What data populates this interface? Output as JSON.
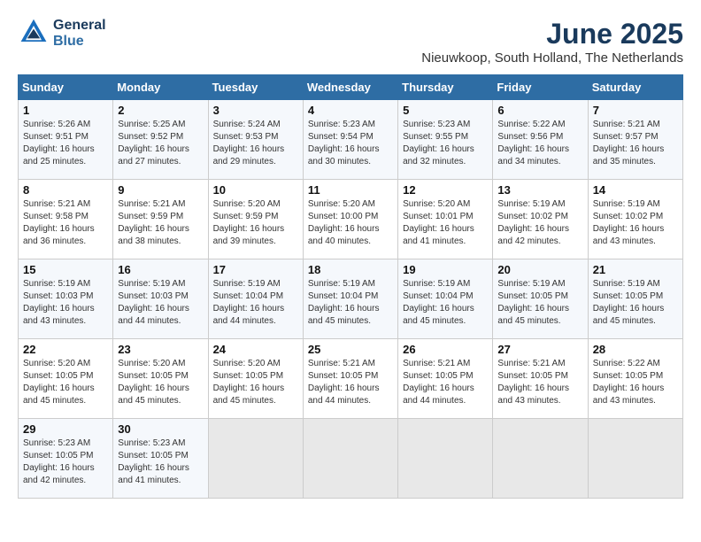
{
  "header": {
    "logo_line1": "General",
    "logo_line2": "Blue",
    "month_year": "June 2025",
    "location": "Nieuwkoop, South Holland, The Netherlands"
  },
  "weekdays": [
    "Sunday",
    "Monday",
    "Tuesday",
    "Wednesday",
    "Thursday",
    "Friday",
    "Saturday"
  ],
  "weeks": [
    [
      {
        "day": "1",
        "rise": "Sunrise: 5:26 AM",
        "set": "Sunset: 9:51 PM",
        "daylight": "Daylight: 16 hours and 25 minutes."
      },
      {
        "day": "2",
        "rise": "Sunrise: 5:25 AM",
        "set": "Sunset: 9:52 PM",
        "daylight": "Daylight: 16 hours and 27 minutes."
      },
      {
        "day": "3",
        "rise": "Sunrise: 5:24 AM",
        "set": "Sunset: 9:53 PM",
        "daylight": "Daylight: 16 hours and 29 minutes."
      },
      {
        "day": "4",
        "rise": "Sunrise: 5:23 AM",
        "set": "Sunset: 9:54 PM",
        "daylight": "Daylight: 16 hours and 30 minutes."
      },
      {
        "day": "5",
        "rise": "Sunrise: 5:23 AM",
        "set": "Sunset: 9:55 PM",
        "daylight": "Daylight: 16 hours and 32 minutes."
      },
      {
        "day": "6",
        "rise": "Sunrise: 5:22 AM",
        "set": "Sunset: 9:56 PM",
        "daylight": "Daylight: 16 hours and 34 minutes."
      },
      {
        "day": "7",
        "rise": "Sunrise: 5:21 AM",
        "set": "Sunset: 9:57 PM",
        "daylight": "Daylight: 16 hours and 35 minutes."
      }
    ],
    [
      {
        "day": "8",
        "rise": "Sunrise: 5:21 AM",
        "set": "Sunset: 9:58 PM",
        "daylight": "Daylight: 16 hours and 36 minutes."
      },
      {
        "day": "9",
        "rise": "Sunrise: 5:21 AM",
        "set": "Sunset: 9:59 PM",
        "daylight": "Daylight: 16 hours and 38 minutes."
      },
      {
        "day": "10",
        "rise": "Sunrise: 5:20 AM",
        "set": "Sunset: 9:59 PM",
        "daylight": "Daylight: 16 hours and 39 minutes."
      },
      {
        "day": "11",
        "rise": "Sunrise: 5:20 AM",
        "set": "Sunset: 10:00 PM",
        "daylight": "Daylight: 16 hours and 40 minutes."
      },
      {
        "day": "12",
        "rise": "Sunrise: 5:20 AM",
        "set": "Sunset: 10:01 PM",
        "daylight": "Daylight: 16 hours and 41 minutes."
      },
      {
        "day": "13",
        "rise": "Sunrise: 5:19 AM",
        "set": "Sunset: 10:02 PM",
        "daylight": "Daylight: 16 hours and 42 minutes."
      },
      {
        "day": "14",
        "rise": "Sunrise: 5:19 AM",
        "set": "Sunset: 10:02 PM",
        "daylight": "Daylight: 16 hours and 43 minutes."
      }
    ],
    [
      {
        "day": "15",
        "rise": "Sunrise: 5:19 AM",
        "set": "Sunset: 10:03 PM",
        "daylight": "Daylight: 16 hours and 43 minutes."
      },
      {
        "day": "16",
        "rise": "Sunrise: 5:19 AM",
        "set": "Sunset: 10:03 PM",
        "daylight": "Daylight: 16 hours and 44 minutes."
      },
      {
        "day": "17",
        "rise": "Sunrise: 5:19 AM",
        "set": "Sunset: 10:04 PM",
        "daylight": "Daylight: 16 hours and 44 minutes."
      },
      {
        "day": "18",
        "rise": "Sunrise: 5:19 AM",
        "set": "Sunset: 10:04 PM",
        "daylight": "Daylight: 16 hours and 45 minutes."
      },
      {
        "day": "19",
        "rise": "Sunrise: 5:19 AM",
        "set": "Sunset: 10:04 PM",
        "daylight": "Daylight: 16 hours and 45 minutes."
      },
      {
        "day": "20",
        "rise": "Sunrise: 5:19 AM",
        "set": "Sunset: 10:05 PM",
        "daylight": "Daylight: 16 hours and 45 minutes."
      },
      {
        "day": "21",
        "rise": "Sunrise: 5:19 AM",
        "set": "Sunset: 10:05 PM",
        "daylight": "Daylight: 16 hours and 45 minutes."
      }
    ],
    [
      {
        "day": "22",
        "rise": "Sunrise: 5:20 AM",
        "set": "Sunset: 10:05 PM",
        "daylight": "Daylight: 16 hours and 45 minutes."
      },
      {
        "day": "23",
        "rise": "Sunrise: 5:20 AM",
        "set": "Sunset: 10:05 PM",
        "daylight": "Daylight: 16 hours and 45 minutes."
      },
      {
        "day": "24",
        "rise": "Sunrise: 5:20 AM",
        "set": "Sunset: 10:05 PM",
        "daylight": "Daylight: 16 hours and 45 minutes."
      },
      {
        "day": "25",
        "rise": "Sunrise: 5:21 AM",
        "set": "Sunset: 10:05 PM",
        "daylight": "Daylight: 16 hours and 44 minutes."
      },
      {
        "day": "26",
        "rise": "Sunrise: 5:21 AM",
        "set": "Sunset: 10:05 PM",
        "daylight": "Daylight: 16 hours and 44 minutes."
      },
      {
        "day": "27",
        "rise": "Sunrise: 5:21 AM",
        "set": "Sunset: 10:05 PM",
        "daylight": "Daylight: 16 hours and 43 minutes."
      },
      {
        "day": "28",
        "rise": "Sunrise: 5:22 AM",
        "set": "Sunset: 10:05 PM",
        "daylight": "Daylight: 16 hours and 43 minutes."
      }
    ],
    [
      {
        "day": "29",
        "rise": "Sunrise: 5:23 AM",
        "set": "Sunset: 10:05 PM",
        "daylight": "Daylight: 16 hours and 42 minutes."
      },
      {
        "day": "30",
        "rise": "Sunrise: 5:23 AM",
        "set": "Sunset: 10:05 PM",
        "daylight": "Daylight: 16 hours and 41 minutes."
      },
      {
        "day": "",
        "rise": "",
        "set": "",
        "daylight": ""
      },
      {
        "day": "",
        "rise": "",
        "set": "",
        "daylight": ""
      },
      {
        "day": "",
        "rise": "",
        "set": "",
        "daylight": ""
      },
      {
        "day": "",
        "rise": "",
        "set": "",
        "daylight": ""
      },
      {
        "day": "",
        "rise": "",
        "set": "",
        "daylight": ""
      }
    ]
  ]
}
